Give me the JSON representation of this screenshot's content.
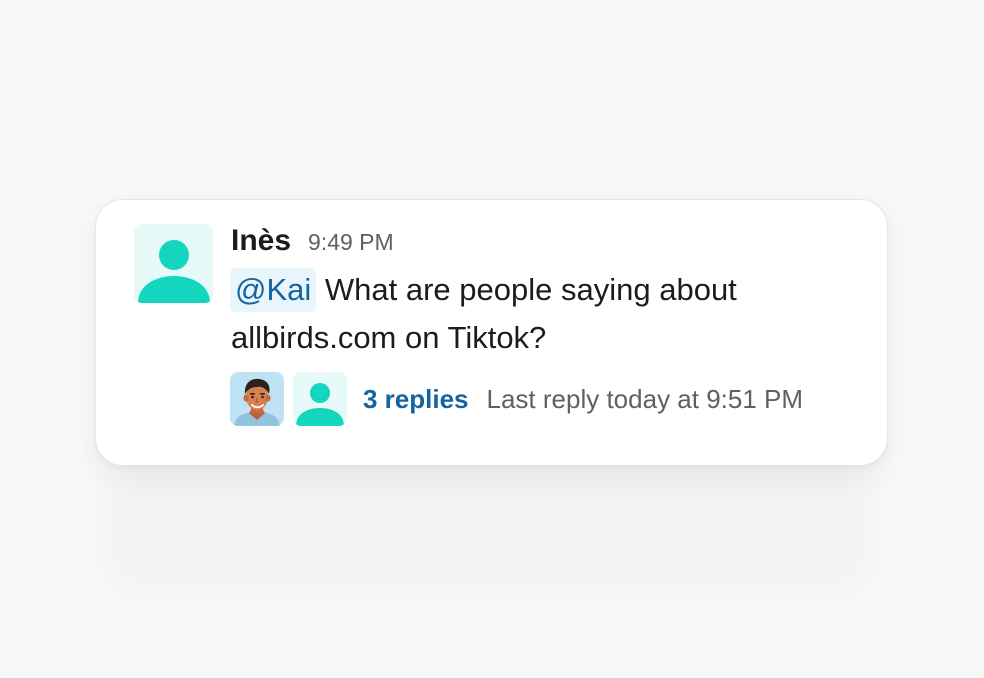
{
  "message": {
    "author": "Inès",
    "timestamp": "9:49 PM",
    "mention": "@Kai",
    "text": "What are people saying about allbirds.com on Tiktok?",
    "author_avatar_icon": "generic-user-icon"
  },
  "thread": {
    "replies_label": "3 replies",
    "last_reply": "Last reply today at 9:51 PM",
    "participants": [
      {
        "icon": "participant-photo-avatar"
      },
      {
        "icon": "generic-user-icon"
      }
    ]
  },
  "colors": {
    "avatar_teal": "#14d6bf",
    "avatar_bg": "#e6faf7",
    "mention_bg": "#e8f5fa",
    "link_blue": "#1264a3",
    "muted_text": "#616061"
  }
}
